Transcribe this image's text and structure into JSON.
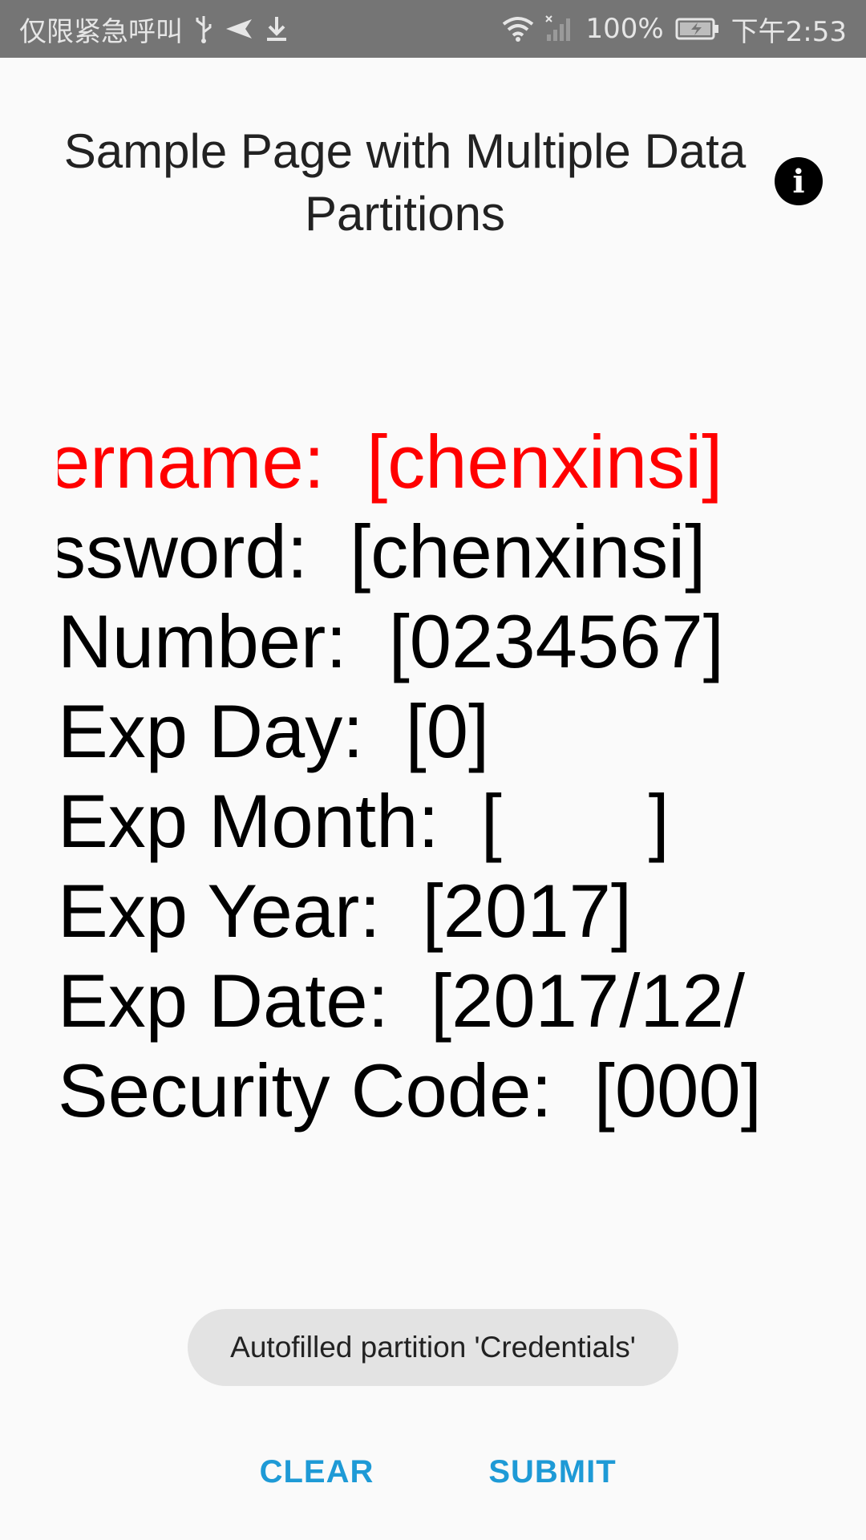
{
  "status_bar": {
    "carrier_text": "仅限紧急呼叫",
    "battery": "100%",
    "time": "下午2:53",
    "icons": [
      "usb-icon",
      "send-icon",
      "download-icon",
      "wifi-icon",
      "signal-icon",
      "battery-icon"
    ]
  },
  "header": {
    "title": "Sample Page with Multiple Data Partitions",
    "info_icon": "info-icon"
  },
  "fields": [
    {
      "label": "ername:",
      "value": "[chenxinsi]",
      "active": true
    },
    {
      "label": "ssword:",
      "value": "[chenxinsi]",
      "active": false
    },
    {
      "label": "Number:",
      "value": "[0234567]",
      "active": false
    },
    {
      "label": "Exp Day:",
      "value": "[0]",
      "active": false
    },
    {
      "label": "Exp Month:",
      "value": "[       ]",
      "active": false
    },
    {
      "label": "Exp Year:",
      "value": "[2017]",
      "active": false
    },
    {
      "label": "Exp Date:",
      "value": "[2017/12/",
      "active": false
    },
    {
      "label": "Security Code:",
      "value": "[000]",
      "active": false
    }
  ],
  "toast": {
    "text": "Autofilled partition 'Credentials'"
  },
  "actions": {
    "clear_label": "CLEAR",
    "submit_label": "SUBMIT"
  },
  "colors": {
    "status_bar_bg": "#757575",
    "background": "#fafafa",
    "active_field": "#ff0000",
    "accent_button": "#1e9ad6",
    "toast_bg": "#e3e3e3"
  }
}
